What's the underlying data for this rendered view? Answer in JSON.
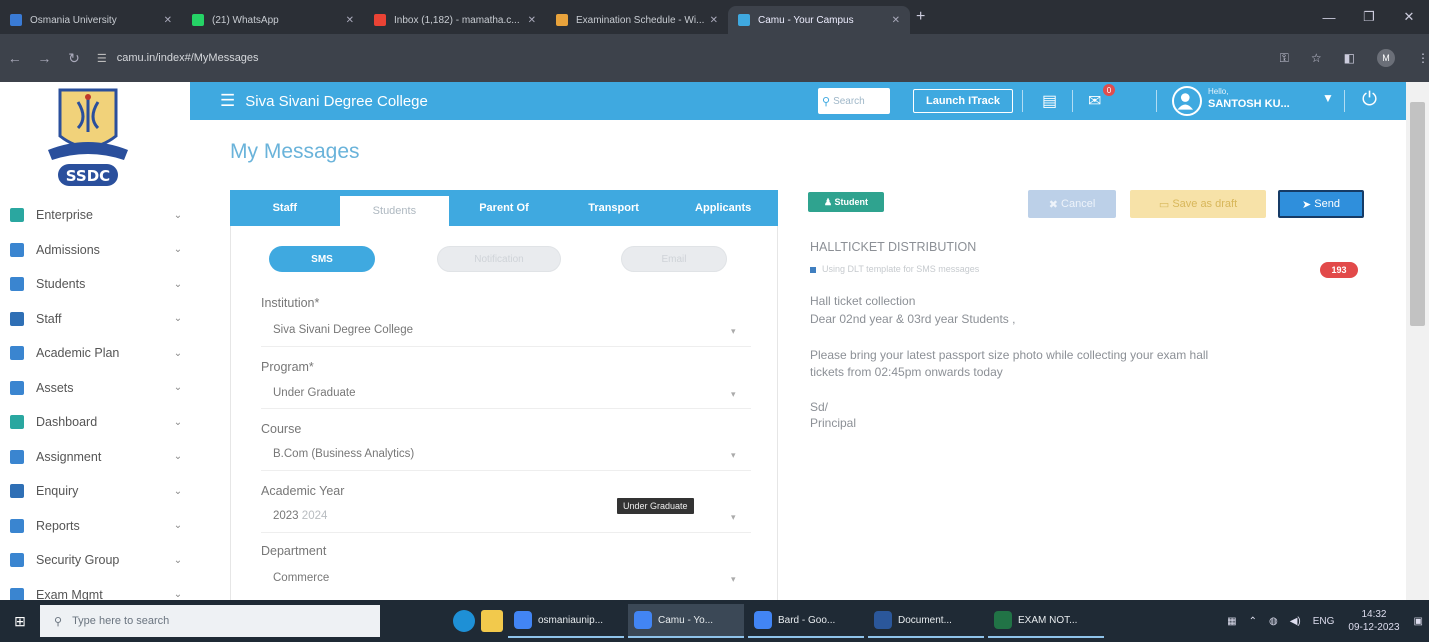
{
  "browser": {
    "tabs": [
      {
        "title": "Osmania University",
        "color": "#3a7bd5",
        "active": false
      },
      {
        "title": "(21) WhatsApp",
        "color": "#25d366",
        "active": false
      },
      {
        "title": "Inbox (1,182) - mamatha.c...",
        "color": "#ea4335",
        "active": false
      },
      {
        "title": "Examination Schedule - Wi...",
        "color": "#e8a33c",
        "active": false
      },
      {
        "title": "Camu - Your Campus",
        "color": "#3fa9e0",
        "active": true
      }
    ],
    "url": "camu.in/index#/MyMessages",
    "profile_initial": "M"
  },
  "app": {
    "college_name": "Siva Sivani Degree College",
    "search_placeholder": "Search",
    "launch_label": "Launch ITrack",
    "notification_count": "0",
    "user_greeting": "Hello,",
    "user_name": "SANTOSH KU...",
    "page_title": "My Messages"
  },
  "sidebar": {
    "items": [
      {
        "label": "Enterprise",
        "color": "#2aa7a0"
      },
      {
        "label": "Admissions",
        "color": "#3a85d0"
      },
      {
        "label": "Students",
        "color": "#3a85d0"
      },
      {
        "label": "Staff",
        "color": "#2f6fb5"
      },
      {
        "label": "Academic Plan",
        "color": "#3a85d0"
      },
      {
        "label": "Assets",
        "color": "#3a85d0"
      },
      {
        "label": "Dashboard",
        "color": "#2aa7a0"
      },
      {
        "label": "Assignment",
        "color": "#3a85d0"
      },
      {
        "label": "Enquiry",
        "color": "#2f6fb5"
      },
      {
        "label": "Reports",
        "color": "#3a85d0"
      },
      {
        "label": "Security Group",
        "color": "#3a85d0"
      },
      {
        "label": "Exam Mgmt",
        "color": "#3a85d0"
      }
    ]
  },
  "message_tabs": [
    "Staff",
    "Students",
    "Parent Of",
    "Transport",
    "Applicants"
  ],
  "active_tab": "Students",
  "channels": {
    "active": "SMS",
    "disabled": [
      "Notification",
      "Email"
    ]
  },
  "form": {
    "institution": {
      "label": "Institution*",
      "value": "Siva Sivani Degree College"
    },
    "program": {
      "label": "Program*",
      "value": "Under Graduate"
    },
    "course": {
      "label": "Course",
      "value": "B.Com (Business Analytics)"
    },
    "academic_year": {
      "label": "Academic Year",
      "value_main": "2023",
      "value_dim": "2024"
    },
    "department": {
      "label": "Department",
      "value": "Commerce"
    },
    "tooltip": "Under Graduate"
  },
  "compose": {
    "recipient_badge": "Student",
    "cancel_label": "Cancel",
    "draft_label": "Save as draft",
    "send_label": "Send",
    "subject": "HALLTICKET DISTRIBUTION",
    "note": "Using DLT template for SMS messages",
    "char_count": "193",
    "body": [
      "Hall ticket collection",
      "Dear 02nd year & 03rd year Students ,",
      "Please bring your latest passport size photo while collecting your exam hall",
      "tickets from 02:45pm onwards today",
      "Sd/",
      "Principal"
    ]
  },
  "taskbar": {
    "search_placeholder": "Type here to search",
    "apps": [
      {
        "label": "osmaniaunip...",
        "color": "#4285f4",
        "active": false
      },
      {
        "label": "Camu - Yo...",
        "color": "#4285f4",
        "active": true
      },
      {
        "label": "Bard - Goo...",
        "color": "#4285f4",
        "active": false
      },
      {
        "label": "Document...",
        "color": "#2b579a",
        "active": false
      },
      {
        "label": "EXAM NOT...",
        "color": "#217346",
        "active": false
      }
    ],
    "language": "ENG",
    "time": "14:32",
    "date": "09-12-2023"
  }
}
